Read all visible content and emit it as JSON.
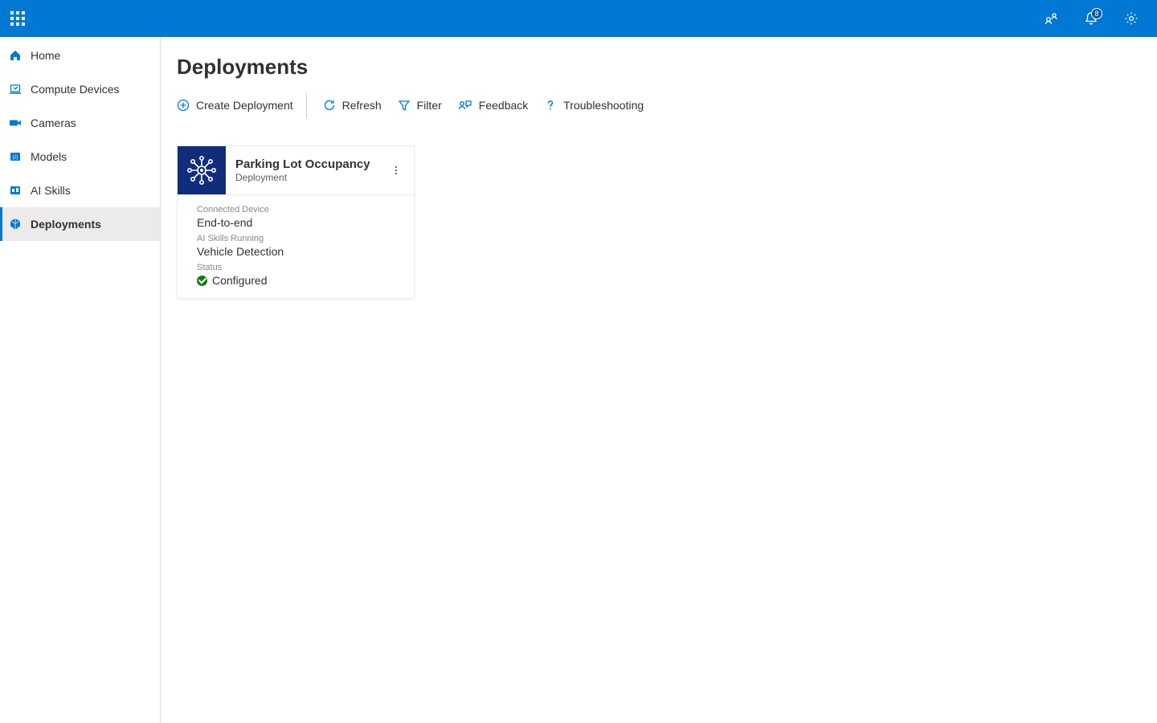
{
  "topbar": {
    "notification_count": "8"
  },
  "sidebar": {
    "items": [
      {
        "label": "Home"
      },
      {
        "label": "Compute Devices"
      },
      {
        "label": "Cameras"
      },
      {
        "label": "Models"
      },
      {
        "label": "AI Skills"
      },
      {
        "label": "Deployments"
      }
    ],
    "active_index": 5
  },
  "page": {
    "title": "Deployments"
  },
  "toolbar": {
    "create_label": "Create Deployment",
    "refresh_label": "Refresh",
    "filter_label": "Filter",
    "feedback_label": "Feedback",
    "troubleshooting_label": "Troubleshooting"
  },
  "card": {
    "title": "Parking Lot Occupancy",
    "subtitle": "Deployment",
    "connected_device_label": "Connected Device",
    "connected_device_value": "End-to-end",
    "ai_skills_label": "AI Skills Running",
    "ai_skills_value": "Vehicle Detection",
    "status_label": "Status",
    "status_value": "Configured"
  }
}
